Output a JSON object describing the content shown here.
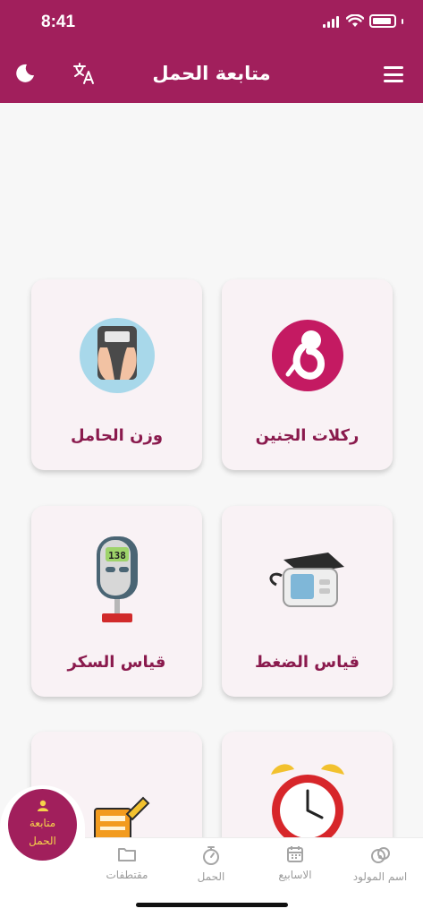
{
  "status": {
    "time": "8:41"
  },
  "header": {
    "title": "متابعة الحمل",
    "moon_icon": "moon-icon",
    "translate_icon": "translate-icon",
    "menu_icon": "hamburger-menu-icon",
    "color": "#a11f5c"
  },
  "cards": [
    {
      "label": "ركلات الجنين",
      "icon": "fetus-icon"
    },
    {
      "label": "وزن الحامل",
      "icon": "scale-icon"
    },
    {
      "label": "قياس الضغط",
      "icon": "blood-pressure-monitor-icon"
    },
    {
      "label": "قياس السكر",
      "icon": "glucometer-icon",
      "reading": "138"
    },
    {
      "label": "",
      "icon": "alarm-clock-icon"
    },
    {
      "label": "",
      "icon": "notepad-icon"
    }
  ],
  "tabs": [
    {
      "label": "اسم المولود",
      "icon": "baby-name-icon"
    },
    {
      "label": "الاسابيع",
      "icon": "calendar-icon"
    },
    {
      "label": "الحمل",
      "icon": "stopwatch-icon"
    },
    {
      "label": "مقتطفات",
      "icon": "folder-icon"
    }
  ],
  "fab": {
    "line1": "متابعة",
    "line2": "الحمل",
    "icon": "person-icon",
    "text_color": "#f6d24a"
  }
}
